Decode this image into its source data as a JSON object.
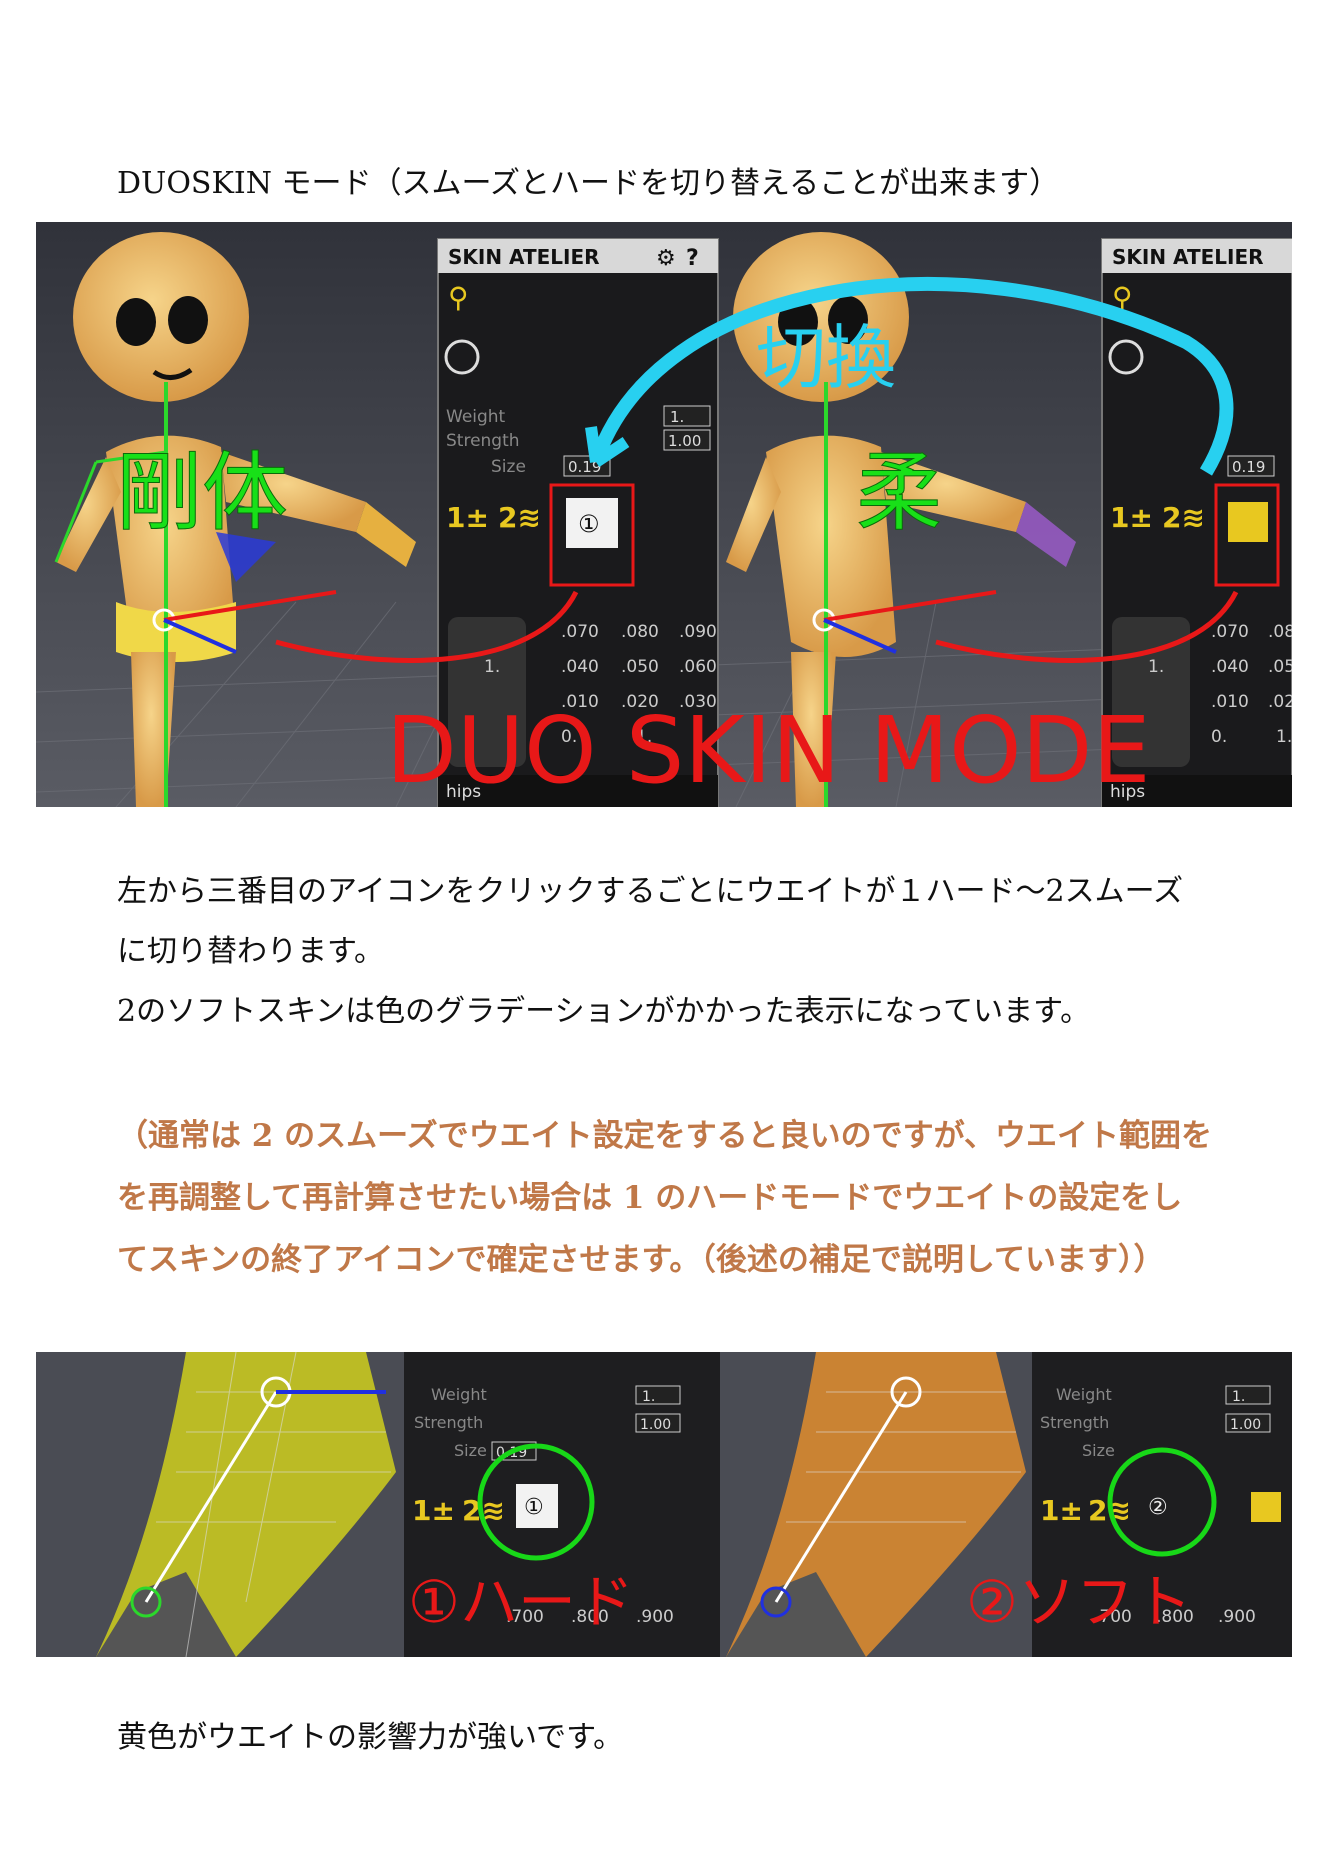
{
  "heading": "DUOSKIN モード（スムーズとハードを切り替えることが出来ます）",
  "screenshot_top": {
    "panel_title": "SKIN ATELIER",
    "panel_title_short": "SKIN ATELIER",
    "weight_label": "Weight",
    "strength_label": "Strength",
    "size_label": "Size",
    "weight_value": "1.",
    "strength_value": "1.00",
    "size_value": "0.19",
    "grid_values_left": [
      ".070",
      ".080",
      ".090",
      "1.",
      ".040",
      ".050",
      ".060",
      ".010",
      ".020",
      ".030",
      "0.",
      "1."
    ],
    "grid_values_right": [
      ".070",
      ".08",
      "1.",
      ".040",
      ".05",
      ".010",
      ".02",
      "0.",
      "1."
    ],
    "bone_label": "hips",
    "annotation_rigid": "剛体",
    "annotation_soft": "柔",
    "annotation_switch": "切換",
    "annotation_mode": "DUO SKIN MODE",
    "colors": {
      "annotation_red": "#e8101a",
      "annotation_cyan": "#28d0f0",
      "annotation_green": "#18e018"
    }
  },
  "body_text": [
    "左から三番目のアイコンをクリックするごとにウエイトが１ハード～2スムーズ",
    "に切り替わります。",
    "2のソフトスキンは色のグラデーションがかかった表示になっています。"
  ],
  "note_text": [
    "（通常は 2 のスムーズでウエイト設定をすると良いのですが、ウエイト範囲を",
    "を再調整して再計算させたい場合は 1 のハードモードでウエイトの設定をし",
    "てスキンの終了アイコンで確定させます。（後述の補足で説明しています））"
  ],
  "screenshot_bottom": {
    "weight_label": "Weight",
    "strength_label": "Strength",
    "size_label": "Size",
    "weight_value": "1.",
    "strength_value": "1.00",
    "size_value": "0.19",
    "label_hard": "①ハード",
    "label_soft": "②ソフト",
    "grid_values_left": [
      ".700",
      ".800",
      ".900"
    ],
    "grid_values_right": [
      ".700",
      ".800",
      ".900"
    ]
  },
  "caption": "黄色がウエイトの影響力が強いです。"
}
